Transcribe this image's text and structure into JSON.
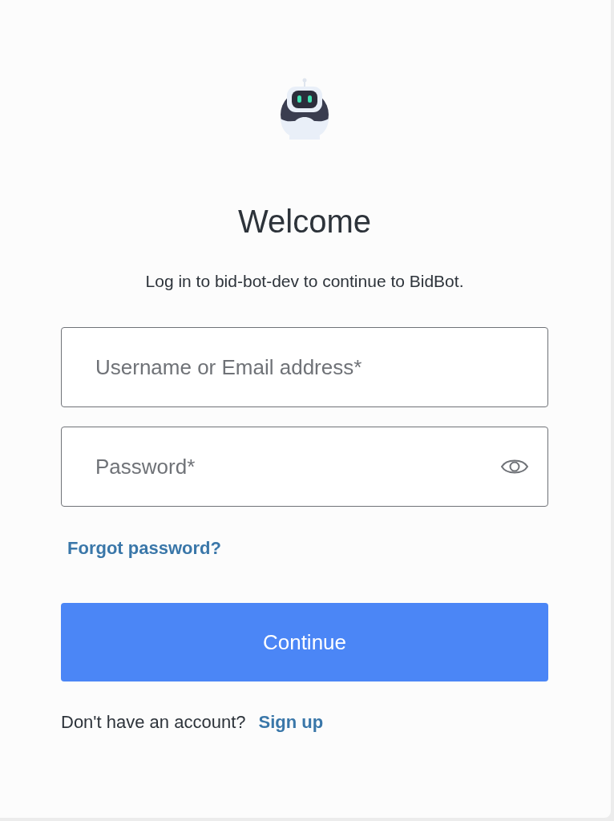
{
  "title": "Welcome",
  "subtitle": "Log in to bid-bot-dev to continue to BidBot.",
  "fields": [
    {
      "kind": "text",
      "placeholder": "Username or Email address*"
    },
    {
      "kind": "password",
      "placeholder": "Password*"
    }
  ],
  "forgot_link": "Forgot password?",
  "continue_button": "Continue",
  "signup_prompt": "Don't have an account?",
  "signup_link": "Sign up"
}
